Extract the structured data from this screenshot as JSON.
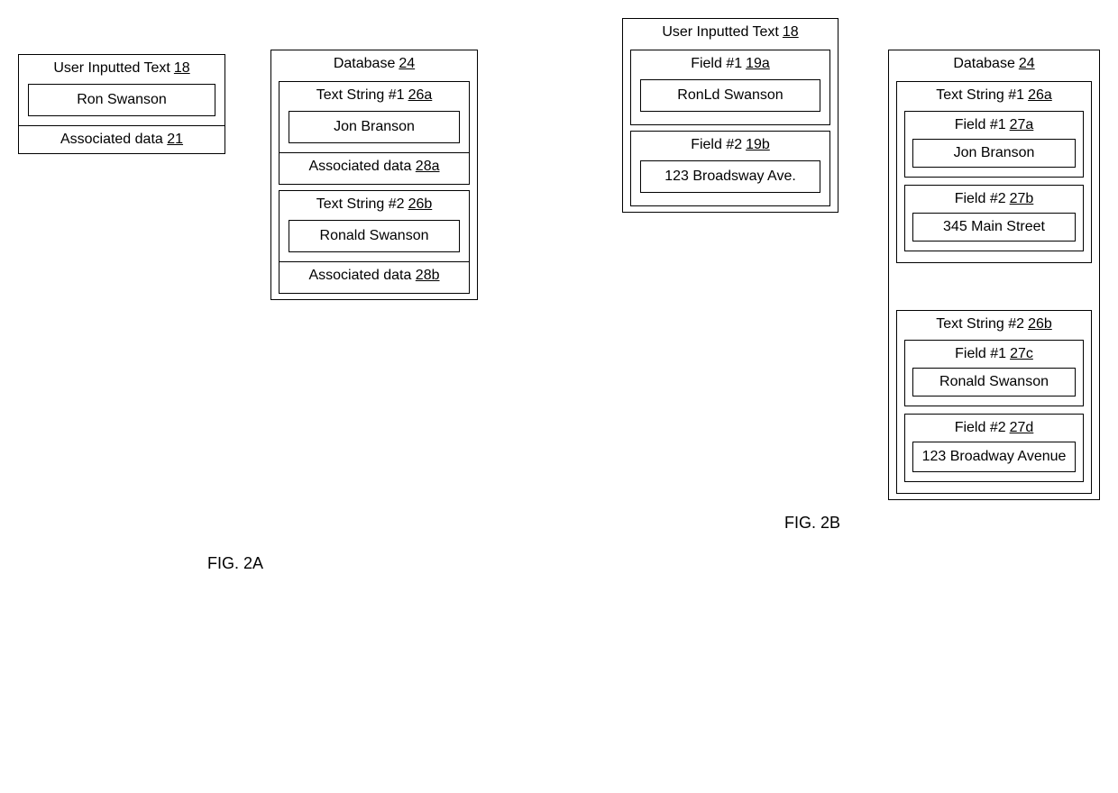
{
  "figA": {
    "caption": "FIG. 2A",
    "userInput": {
      "title": "User Inputted Text",
      "ref": "18",
      "value": "Ron Swanson",
      "assoc_label": "Associated data",
      "assoc_ref": "21"
    },
    "database": {
      "title": "Database",
      "ref": "24",
      "ts1": {
        "title": "Text String #1",
        "ref": "26a",
        "value": "Jon Branson",
        "assoc_label": "Associated data",
        "assoc_ref": "28a"
      },
      "ts2": {
        "title": "Text String #2",
        "ref": "26b",
        "value": "Ronald Swanson",
        "assoc_label": "Associated data",
        "assoc_ref": "28b"
      }
    }
  },
  "figB": {
    "caption": "FIG. 2B",
    "userInput": {
      "title": "User Inputted Text",
      "ref": "18",
      "f1": {
        "title": "Field #1",
        "ref": "19a",
        "value": "RonLd Swanson"
      },
      "f2": {
        "title": "Field #2",
        "ref": "19b",
        "value": "123 Broadsway Ave."
      }
    },
    "database": {
      "title": "Database",
      "ref": "24",
      "ts1": {
        "title": "Text String #1",
        "ref": "26a",
        "f1": {
          "title": "Field #1",
          "ref": "27a",
          "value": "Jon Branson"
        },
        "f2": {
          "title": "Field #2",
          "ref": "27b",
          "value": "345 Main Street"
        }
      },
      "ts2": {
        "title": "Text String #2",
        "ref": "26b",
        "f1": {
          "title": "Field #1",
          "ref": "27c",
          "value": "Ronald Swanson"
        },
        "f2": {
          "title": "Field #2",
          "ref": "27d",
          "value": "123 Broadway Avenue"
        }
      }
    }
  }
}
